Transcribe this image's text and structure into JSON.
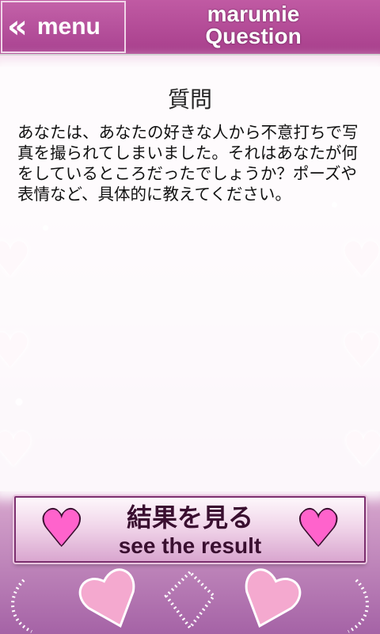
{
  "header": {
    "menu_icon": "double-chevron-left-icon",
    "menu_glyph": "«",
    "menu_label": "menu",
    "title_line1": "marumie",
    "title_line2": "Question"
  },
  "question": {
    "heading": "質問",
    "body": "あなたは、あなたの好きな人から不意打ちで写真を撮られてしまいました。それはあなたが何をしているところだったでしょうか？ポーズや表情など、具体的に教えてください。"
  },
  "result_button": {
    "label_jp": "結果を見る",
    "label_en": "see the result",
    "heart_icon": "heart-icon"
  },
  "colors": {
    "header": "#b14c98",
    "button_text": "#3a0f30",
    "heart": "#ff63cc"
  }
}
